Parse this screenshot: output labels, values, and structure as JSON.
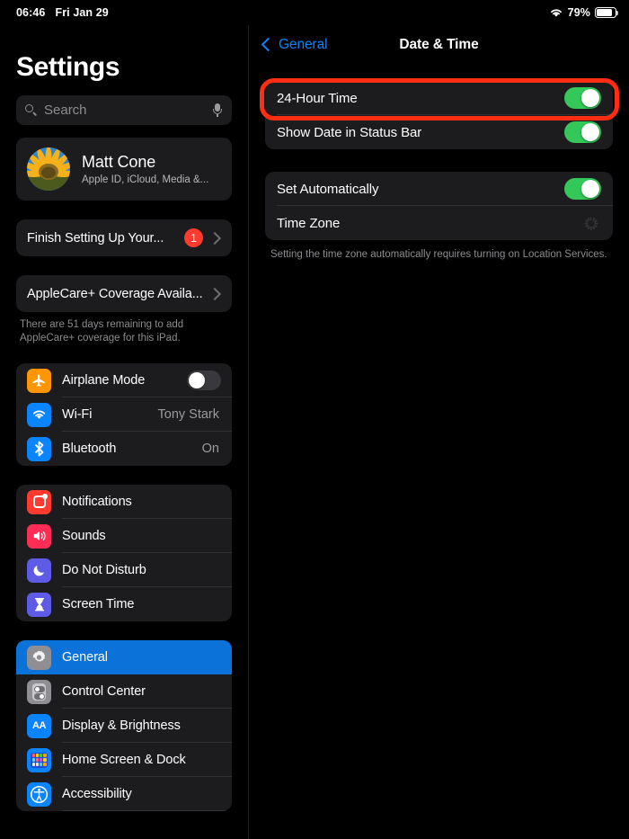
{
  "status_bar": {
    "time": "06:46",
    "date": "Fri Jan 29",
    "wifi_icon": "wifi-icon",
    "battery_percent": "79%",
    "battery_icon": "battery-icon"
  },
  "sidebar": {
    "title": "Settings",
    "search": {
      "placeholder": "Search",
      "search_icon": "search-icon",
      "dictation_icon": "microphone-icon"
    },
    "account": {
      "name": "Matt Cone",
      "subtitle": "Apple ID, iCloud, Media &...",
      "avatar_icon": "sunflower-avatar"
    },
    "promos": [
      {
        "label": "Finish Setting Up Your...",
        "badge": "1",
        "chevron_icon": "chevron-right-icon"
      },
      {
        "label": "AppleCare+ Coverage Availa...",
        "badge": "",
        "chevron_icon": "chevron-right-icon"
      }
    ],
    "applecare_note": "There are 51 days remaining to add AppleCare+ coverage for this iPad.",
    "connectivity": [
      {
        "label": "Airplane Mode",
        "icon": "airplane-icon",
        "value": "",
        "control": "toggle",
        "toggle_on": false
      },
      {
        "label": "Wi-Fi",
        "icon": "wifi-icon",
        "value": "Tony Stark",
        "control": "value",
        "toggle_on": false
      },
      {
        "label": "Bluetooth",
        "icon": "bluetooth-icon",
        "value": "On",
        "control": "value",
        "toggle_on": false
      }
    ],
    "notifications_group": [
      {
        "label": "Notifications",
        "icon": "notifications-icon"
      },
      {
        "label": "Sounds",
        "icon": "sounds-icon"
      },
      {
        "label": "Do Not Disturb",
        "icon": "moon-icon"
      },
      {
        "label": "Screen Time",
        "icon": "hourglass-icon"
      }
    ],
    "general_group": [
      {
        "label": "General",
        "icon": "gear-icon",
        "selected": true
      },
      {
        "label": "Control Center",
        "icon": "control-center-icon",
        "selected": false
      },
      {
        "label": "Display & Brightness",
        "icon": "display-brightness-icon",
        "selected": false
      },
      {
        "label": "Home Screen & Dock",
        "icon": "home-screen-icon",
        "selected": false
      },
      {
        "label": "Accessibility",
        "icon": "accessibility-icon",
        "selected": false
      }
    ]
  },
  "detail": {
    "back_label": "General",
    "back_icon": "chevron-left-icon",
    "title": "Date & Time",
    "group_one": [
      {
        "label": "24-Hour Time",
        "toggle_on": true
      },
      {
        "label": "Show Date in Status Bar",
        "toggle_on": true
      }
    ],
    "group_two": [
      {
        "label": "Set Automatically",
        "control": "toggle",
        "toggle_on": true
      },
      {
        "label": "Time Zone",
        "control": "spinner",
        "toggle_on": false
      }
    ],
    "time_zone_note": "Setting the time zone automatically requires turning on Location Services.",
    "annotation": {
      "target": "24-Hour Time",
      "color": "#ff2d12",
      "shape": "rounded-rectangle-highlight"
    }
  }
}
